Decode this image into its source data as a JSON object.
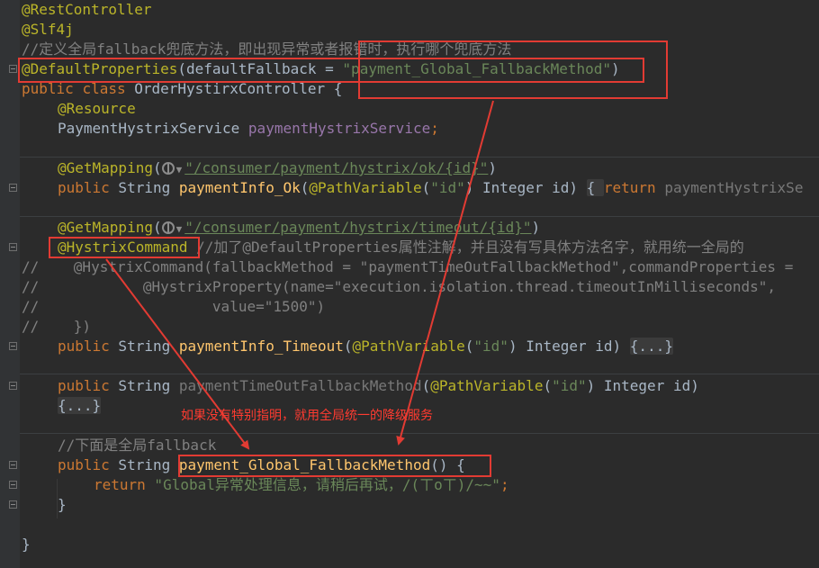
{
  "editor": {
    "code": {
      "rest_controller": "@RestController",
      "slf4j": "@Slf4j",
      "comment_default": "//定义全局fallback兜底方法，即出现异常或者报错时，执行哪个兜底方法",
      "default_props_ann": "@DefaultProperties",
      "default_props_open": "(defaultFallback = ",
      "default_props_value": "\"payment_Global_FallbackMethod\"",
      "default_props_close": ")",
      "class_public": "public",
      "class_kw": "class",
      "class_name": " OrderHystirxController {",
      "resource_ann": "@Resource",
      "service_type": "PaymentHystrixService ",
      "service_field": "paymentHystrixService",
      "semicolon": ";",
      "getmapping_ann": "@GetMapping",
      "paren_open": "(",
      "ok_path": "\"/consumer/payment/hystrix/ok/{id}\"",
      "paren_close": ")",
      "m1_public": "public",
      "m1_sig_a": " String ",
      "m1_name": "paymentInfo_Ok",
      "pathvar_ann": "@PathVariable",
      "id_str": "\"id\"",
      "m1_params": ") Integer id) ",
      "m1_body_open": "{ ",
      "m1_return": "return",
      "m1_rest": " paymentHystrixSe",
      "timeout_path": "\"/consumer/payment/hystrix/timeout/{id}\"",
      "hystrix_ann": "@HystrixCommand",
      "hystrix_comment": "//加了@DefaultProperties属性注解，并且没有写具体方法名字，就用统一全局的",
      "commented_1": "//    @HystrixCommand(fallbackMethod = \"paymentTimeOutFallbackMethod\",commandProperties =",
      "commented_2": "//            @HystrixProperty(name=\"execution.isolation.thread.timeoutInMilliseconds\",",
      "commented_3": "//                    value=\"1500\")",
      "commented_4": "//    })",
      "m2_name": "paymentInfo_Timeout",
      "m2_params": ") Integer id) ",
      "fold_marker": "{...}",
      "m3_unused_name": "paymentTimeOutFallbackMethod",
      "m3_params": ") Integer id)",
      "comment_global": "//下面是全局fallback",
      "m4_name": "payment_Global_FallbackMethod",
      "m4_suffix": "() {",
      "return_kw": "return",
      "return_str": " \"Global异常处理信息，请稍后再试，/(ㄒoㄒ)/~~\"",
      "close_brace": "}"
    },
    "annotation_note": "如果没有特别指明，就用全局统一的降级服务"
  },
  "colors": {
    "background": "#2b2b2b",
    "annotation": "#bbb529",
    "keyword": "#cc7832",
    "string": "#6a8759",
    "comment": "#808080",
    "field": "#9876aa",
    "method": "#ffc66d",
    "highlight_red": "#e23b33"
  }
}
